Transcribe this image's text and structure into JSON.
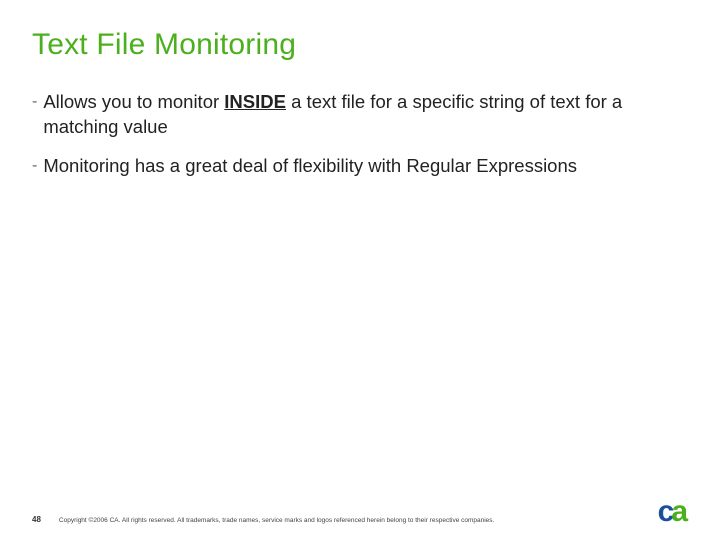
{
  "title": "Text File Monitoring",
  "bullets": [
    {
      "pre": "Allows you to monitor ",
      "emph": "INSIDE",
      "post": " a text file for a specific string of text for a matching value"
    },
    {
      "pre": "Monitoring has a great deal of flexibility with Regular Expressions",
      "emph": "",
      "post": ""
    }
  ],
  "page_number": "48",
  "copyright": "Copyright ©2006 CA. All rights reserved. All trademarks, trade names, service marks and logos referenced herein belong to their respective companies.",
  "logo": {
    "c": "c",
    "a": "a"
  }
}
